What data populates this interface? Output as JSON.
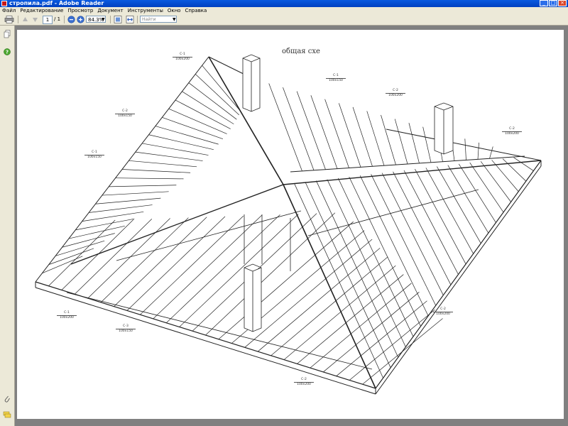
{
  "window": {
    "title": "стропила.pdf - Adobe Reader"
  },
  "menu": [
    "Файл",
    "Редактирование",
    "Просмотр",
    "Документ",
    "Инструменты",
    "Окно",
    "Справка"
  ],
  "toolbar": {
    "page_current": "1",
    "page_total": "/ 1",
    "zoom": "84.3%",
    "search_placeholder": "Найти"
  },
  "document": {
    "title": "общая схе",
    "labels": [
      {
        "code": "С-1",
        "size": "100x200"
      },
      {
        "code": "С-1",
        "size": "100x150"
      },
      {
        "code": "С-2",
        "size": "100x200"
      },
      {
        "code": "С-2",
        "size": "100x150"
      },
      {
        "code": "С-1",
        "size": "100x150"
      },
      {
        "code": "С-2",
        "size": "100x200"
      },
      {
        "code": "С-2",
        "size": "100x200"
      },
      {
        "code": "С-3",
        "size": "100x150"
      },
      {
        "code": "С-1",
        "size": "100x200"
      },
      {
        "code": "С-2",
        "size": "100x200"
      }
    ]
  }
}
